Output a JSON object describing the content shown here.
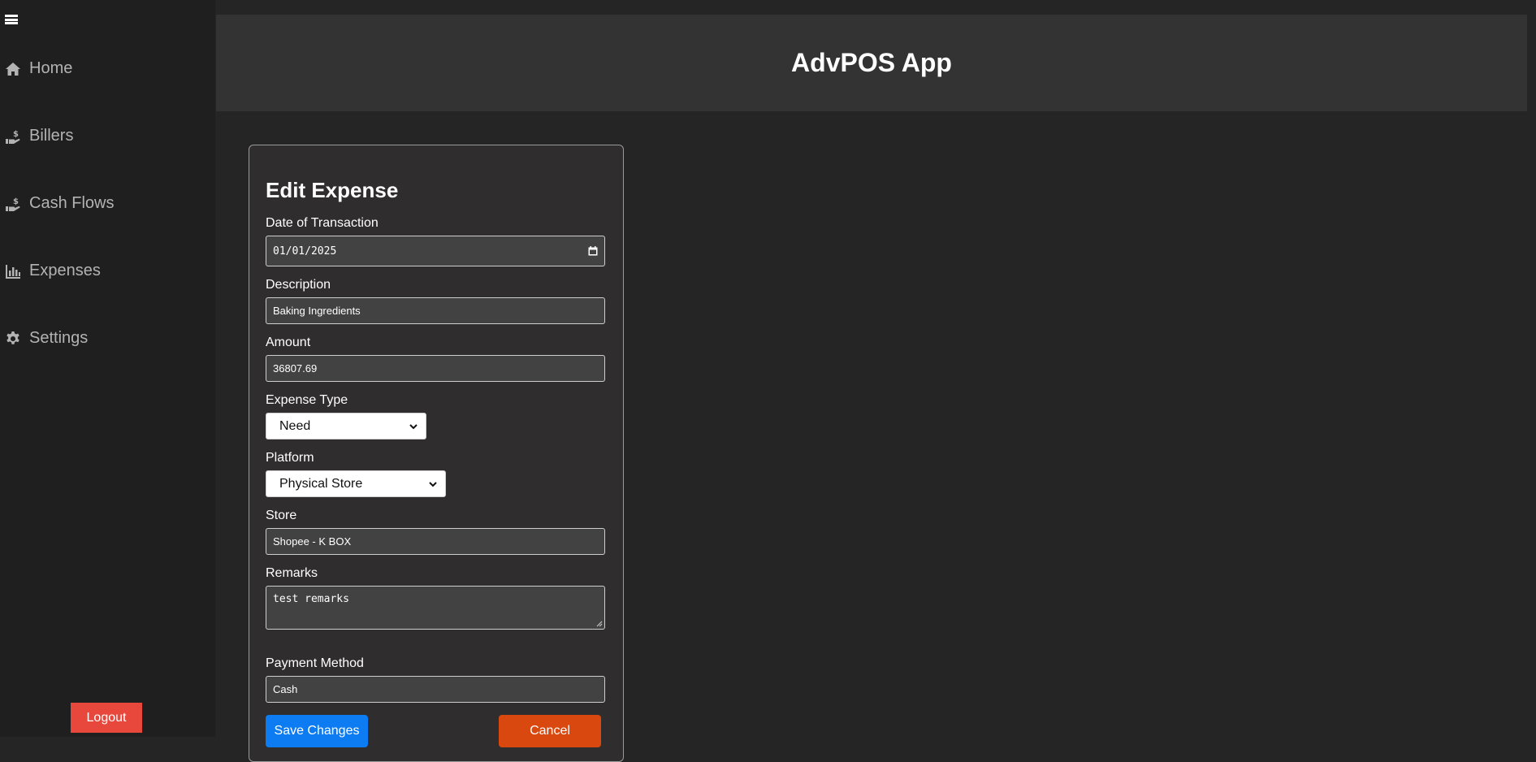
{
  "app": {
    "title": "AdvPOS App"
  },
  "sidebar": {
    "items": [
      {
        "label": "Home",
        "icon": "home-icon"
      },
      {
        "label": "Billers",
        "icon": "hand-dollar-icon"
      },
      {
        "label": "Cash Flows",
        "icon": "hand-dollar-icon"
      },
      {
        "label": "Expenses",
        "icon": "bar-chart-icon"
      },
      {
        "label": "Settings",
        "icon": "gear-icon"
      }
    ],
    "logout_label": "Logout"
  },
  "form": {
    "title": "Edit Expense",
    "date": {
      "label": "Date of Transaction",
      "value": "01/01/2025"
    },
    "description": {
      "label": "Description",
      "value": "Baking Ingredients"
    },
    "amount": {
      "label": "Amount",
      "value": "36807.69"
    },
    "expense_type": {
      "label": "Expense Type",
      "value": "Need"
    },
    "platform": {
      "label": "Platform",
      "value": "Physical Store"
    },
    "store": {
      "label": "Store",
      "value": "Shopee - K BOX"
    },
    "remarks": {
      "label": "Remarks",
      "value": "test remarks"
    },
    "payment_method": {
      "label": "Payment Method",
      "value": "Cash"
    },
    "save_label": "Save Changes",
    "cancel_label": "Cancel"
  },
  "colors": {
    "background": "#252525",
    "sidebar": "#1f1f1f",
    "header": "#333333",
    "card": "#2f2d2d",
    "logout": "#e8473b",
    "save": "#0d7cf2",
    "cancel": "#d9490f"
  }
}
